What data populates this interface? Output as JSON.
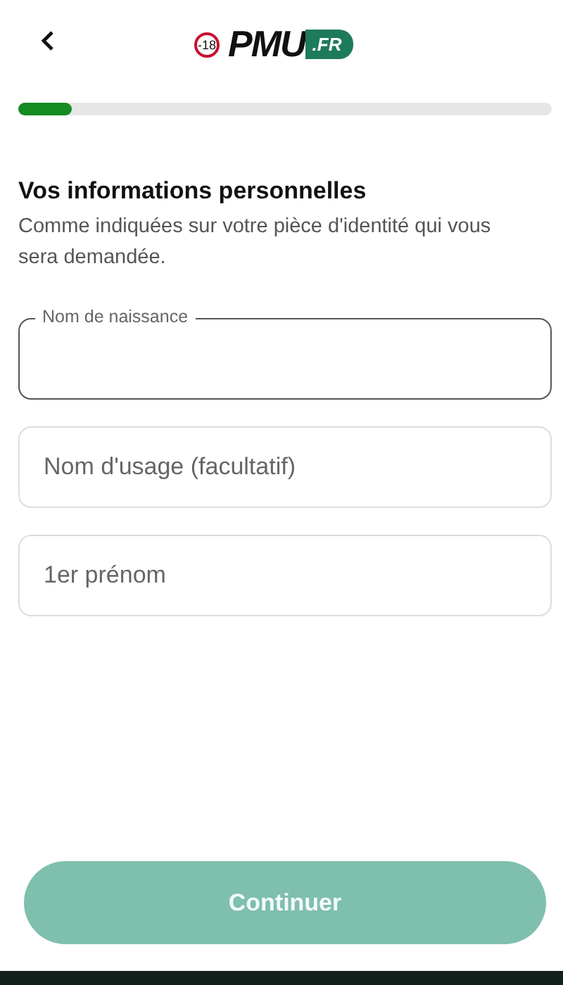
{
  "header": {
    "age_badge": "-18",
    "logo_main": "PMU",
    "logo_suffix": ".FR"
  },
  "progress": {
    "level": 0.1
  },
  "title": "Vos informations personnelles",
  "subtitle": "Comme indiquées sur votre pièce d'identité qui vous sera demandée.",
  "fields": [
    {
      "label": "Nom de naissance",
      "focused": true
    },
    {
      "placeholder": "Nom d'usage (facultatif)",
      "focused": false
    },
    {
      "placeholder": "1er prénom",
      "focused": false
    }
  ],
  "continue_button": {
    "label": "Continuer",
    "disabled": true
  }
}
